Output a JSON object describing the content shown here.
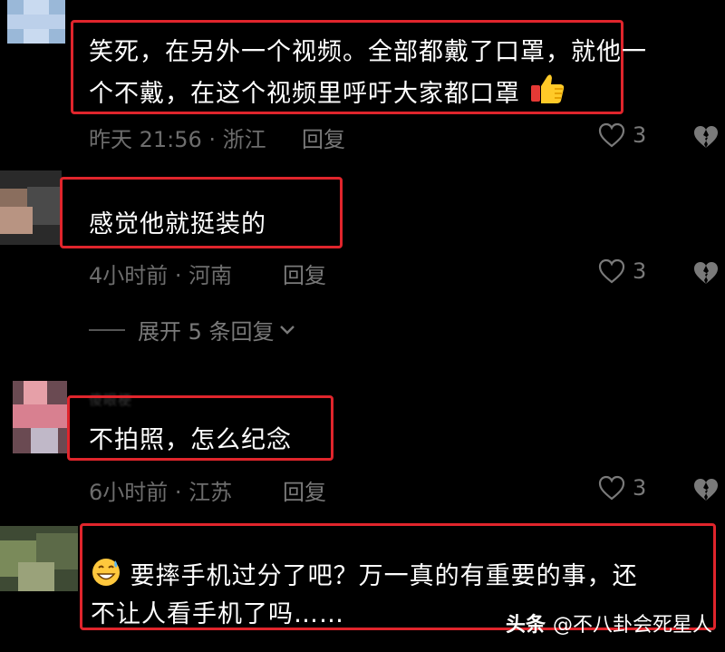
{
  "comments": [
    {
      "username": "",
      "text_line1": "笑死，在另外一个视频。全部都戴了口罩，就他一",
      "text_line2": "个不戴，在这个视频里呼吁大家都口罩",
      "emoji": "thumbs-up",
      "time_location": "昨天 21:56 · 浙江",
      "reply_label": "回复",
      "likes": "3"
    },
    {
      "username": "",
      "text_line1": "感觉他就挺装的",
      "time_location": "4小时前 · 河南",
      "reply_label": "回复",
      "likes": "3",
      "expand_label": "展开 5 条回复"
    },
    {
      "username": "傻眼梗",
      "text_line1": "不拍照，怎么纪念",
      "time_location": "6小时前 · 江苏",
      "reply_label": "回复",
      "likes": "3"
    },
    {
      "username": "",
      "emoji": "grinning-sweat",
      "text_line1": "要摔手机过分了吧？万一真的有重要的事，还",
      "text_line2": "不让人看手机了吗……"
    }
  ],
  "watermark": {
    "brand": "头条",
    "handle": "@不八卦会死星人"
  },
  "colors": {
    "highlight_border": "#e0252c",
    "background": "#000000",
    "meta_text": "#6d6d6d"
  }
}
